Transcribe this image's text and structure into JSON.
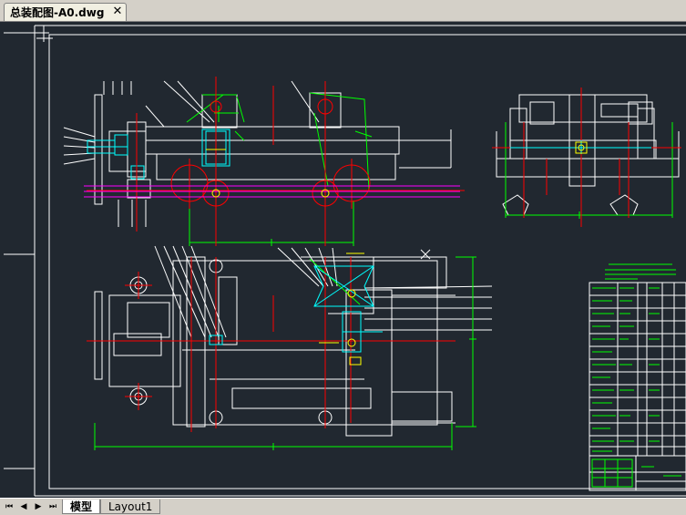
{
  "document_tab": {
    "title": "总装配图-A0.dwg",
    "close_symbol": "✕"
  },
  "layout_tabs": {
    "nav": [
      "⏮",
      "◀",
      "▶",
      "⏭"
    ],
    "model_label": "模型",
    "layout_label": "Layout1"
  },
  "colors": {
    "canvas_bg": "#212830",
    "line_white": "#ffffff",
    "line_green": "#00ff00",
    "line_red": "#ff0000",
    "line_cyan": "#00ffff",
    "line_magenta": "#ff00ff",
    "line_yellow": "#ffff00"
  }
}
